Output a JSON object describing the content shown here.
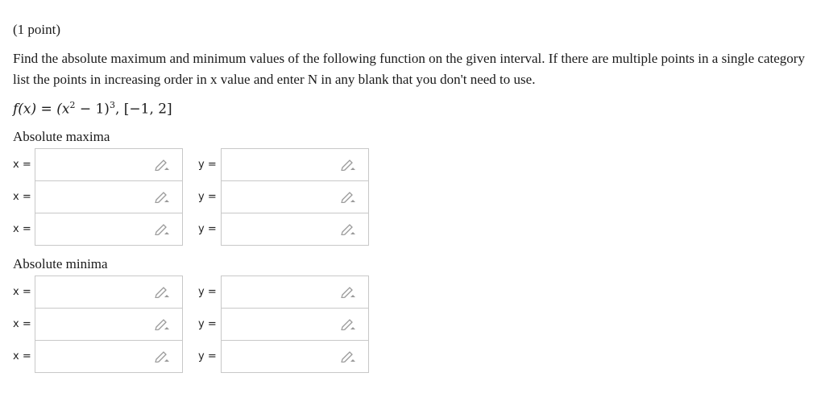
{
  "problem": {
    "points": "(1 point)",
    "prompt": "Find the absolute maximum and minimum values of the following function on the given interval. If there are multiple points in a single category list the points in increasing order in x value and enter N in any blank that you don't need to use.",
    "formula": {
      "lhs": "f(x) = ",
      "base": "(x",
      "exp1": "2",
      "mid": " − 1)",
      "exp2": "3",
      "interval": ",  [−1, 2]"
    }
  },
  "maxima": {
    "title": "Absolute maxima",
    "rows": [
      {
        "x_label": "x =",
        "y_label": "y =",
        "x_value": "",
        "y_value": ""
      },
      {
        "x_label": "x =",
        "y_label": "y =",
        "x_value": "",
        "y_value": ""
      },
      {
        "x_label": "x =",
        "y_label": "y =",
        "x_value": "",
        "y_value": ""
      }
    ]
  },
  "minima": {
    "title": "Absolute minima",
    "rows": [
      {
        "x_label": "x =",
        "y_label": "y =",
        "x_value": "",
        "y_value": ""
      },
      {
        "x_label": "x =",
        "y_label": "y =",
        "x_value": "",
        "y_value": ""
      },
      {
        "x_label": "x =",
        "y_label": "y =",
        "x_value": "",
        "y_value": ""
      }
    ]
  },
  "icons": {
    "equation_editor": "pencil-icon"
  },
  "colors": {
    "input_border": "#c8c8c8",
    "icon": "#9a9a9a"
  }
}
